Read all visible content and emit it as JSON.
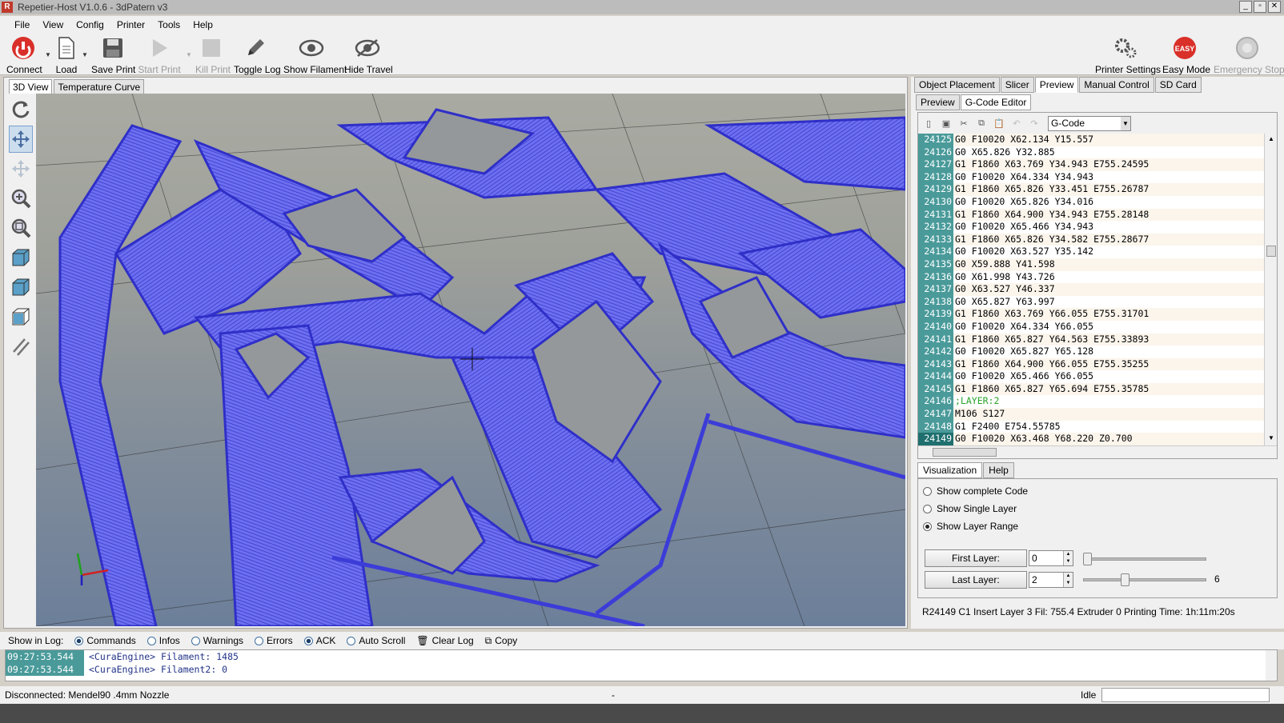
{
  "window": {
    "title": "Repetier-Host V1.0.6 - 3dPatern v3",
    "app_icon": "R"
  },
  "menu": [
    "File",
    "View",
    "Config",
    "Printer",
    "Tools",
    "Help"
  ],
  "toolbar": {
    "connect": "Connect",
    "load": "Load",
    "save_print": "Save Print",
    "start_print": "Start Print",
    "kill_print": "Kill Print",
    "toggle_log": "Toggle Log",
    "show_filament": "Show Filament",
    "hide_travel": "Hide Travel",
    "printer_settings": "Printer Settings",
    "easy_mode": "Easy Mode",
    "easy_badge": "EASY",
    "emergency_stop": "Emergency Stop"
  },
  "left_tabs": [
    "3D View",
    "Temperature Curve"
  ],
  "right_tabs": [
    "Object Placement",
    "Slicer",
    "Preview",
    "Manual Control",
    "SD Card"
  ],
  "sub_tabs": [
    "Preview",
    "G-Code Editor"
  ],
  "editor": {
    "file_select": "G-Code",
    "lines": [
      {
        "n": "24125",
        "t": "G0 F10020 X62.134 Y15.557"
      },
      {
        "n": "24126",
        "t": "G0 X65.826 Y32.885"
      },
      {
        "n": "24127",
        "t": "G1 F1860 X63.769 Y34.943 E755.24595"
      },
      {
        "n": "24128",
        "t": "G0 F10020 X64.334 Y34.943"
      },
      {
        "n": "24129",
        "t": "G1 F1860 X65.826 Y33.451 E755.26787"
      },
      {
        "n": "24130",
        "t": "G0 F10020 X65.826 Y34.016"
      },
      {
        "n": "24131",
        "t": "G1 F1860 X64.900 Y34.943 E755.28148"
      },
      {
        "n": "24132",
        "t": "G0 F10020 X65.466 Y34.943"
      },
      {
        "n": "24133",
        "t": "G1 F1860 X65.826 Y34.582 E755.28677"
      },
      {
        "n": "24134",
        "t": "G0 F10020 X63.527 Y35.142"
      },
      {
        "n": "24135",
        "t": "G0 X59.888 Y41.598"
      },
      {
        "n": "24136",
        "t": "G0 X61.998 Y43.726"
      },
      {
        "n": "24137",
        "t": "G0 X63.527 Y46.337"
      },
      {
        "n": "24138",
        "t": "G0 X65.827 Y63.997"
      },
      {
        "n": "24139",
        "t": "G1 F1860 X63.769 Y66.055 E755.31701"
      },
      {
        "n": "24140",
        "t": "G0 F10020 X64.334 Y66.055"
      },
      {
        "n": "24141",
        "t": "G1 F1860 X65.827 Y64.563 E755.33893"
      },
      {
        "n": "24142",
        "t": "G0 F10020 X65.827 Y65.128"
      },
      {
        "n": "24143",
        "t": "G1 F1860 X64.900 Y66.055 E755.35255"
      },
      {
        "n": "24144",
        "t": "G0 F10020 X65.466 Y66.055"
      },
      {
        "n": "24145",
        "t": "G1 F1860 X65.827 Y65.694 E755.35785"
      },
      {
        "n": "24146",
        "t": ";LAYER:2"
      },
      {
        "n": "24147",
        "t": "M106 S127"
      },
      {
        "n": "24148",
        "t": "G1 F2400 E754.55785"
      },
      {
        "n": "24149",
        "t": "G0 F10020 X63.468 Y68.220 Z0.700"
      }
    ]
  },
  "visualization": {
    "tabs": [
      "Visualization",
      "Help"
    ],
    "opt_complete": "Show complete Code",
    "opt_single": "Show Single Layer",
    "opt_range": "Show Layer Range",
    "first_layer_label": "First Layer:",
    "first_layer_value": "0",
    "last_layer_label": "Last Layer:",
    "last_layer_value": "2",
    "max_layer": "6"
  },
  "editor_status": "R24149  C1  Insert  Layer 3 Fil: 755.4  Extruder 0   Printing Time: 1h:11m:20s",
  "log": {
    "show_in_log": "Show in Log:",
    "commands": "Commands",
    "infos": "Infos",
    "warnings": "Warnings",
    "errors": "Errors",
    "ack": "ACK",
    "auto_scroll": "Auto Scroll",
    "clear_log": "Clear Log",
    "copy": "Copy",
    "entries": [
      {
        "time": "09:27:53.544",
        "msg": "<CuraEngine> Filament: 1485"
      },
      {
        "time": "09:27:53.544",
        "msg": "<CuraEngine> Filament2: 0"
      }
    ]
  },
  "statusbar": {
    "connection": "Disconnected: Mendel90 .4mm Nozzle",
    "middle": "-",
    "state": "Idle"
  }
}
